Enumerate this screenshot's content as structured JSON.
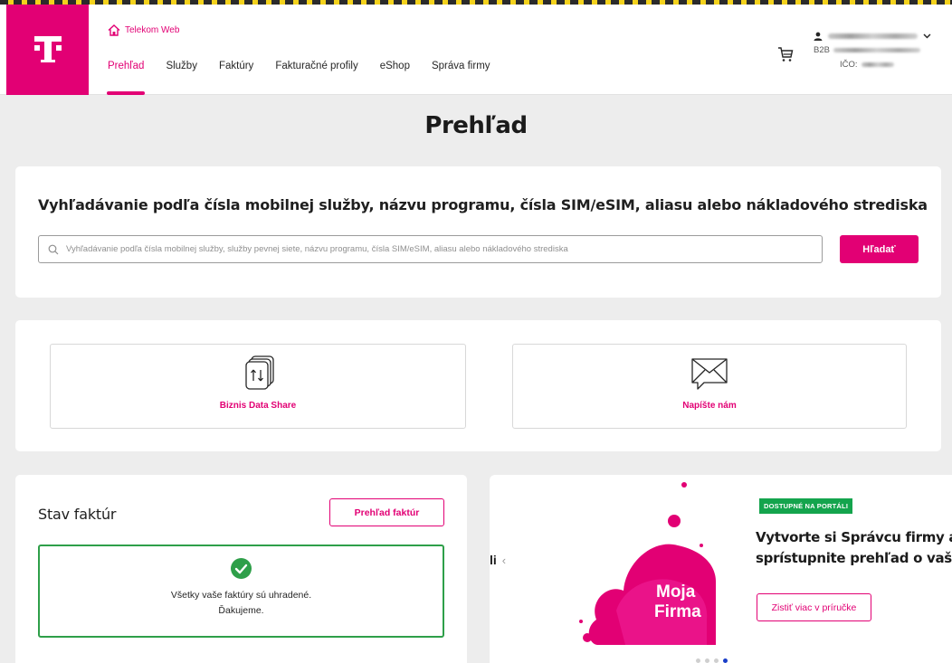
{
  "header": {
    "portal_label": "Telekom Web",
    "nav": [
      "Prehľad",
      "Služby",
      "Faktúry",
      "Fakturačné profily",
      "eShop",
      "Správa firmy"
    ],
    "active_nav": 0,
    "user": {
      "company_prefix": "B2B",
      "ico_label": "IČO:"
    }
  },
  "page": {
    "title": "Prehľad"
  },
  "search": {
    "heading": "Vyhľadávanie podľa čísla mobilnej služby, názvu programu, čísla SIM/eSIM, aliasu alebo nákladového strediska",
    "placeholder": "Vyhľadávanie podľa čísla mobilnej služby, služby pevnej siete, názvu programu, čísla SIM/eSIM, aliasu alebo nákladového strediska",
    "value": "",
    "button_label": "Hľadať"
  },
  "quick_links": [
    {
      "label": "Biznis Data Share",
      "icon": "data-share-icon"
    },
    {
      "label": "Napíšte nám",
      "icon": "mail-icon"
    }
  ],
  "invoices": {
    "title": "Stav faktúr",
    "button_label": "Prehľad faktúr",
    "status_line1": "Všetky vaše faktúry sú uhradené.",
    "status_line2": "Ďakujeme."
  },
  "promo": {
    "prev_text": "li",
    "badge": "DOSTUPNÉ NA PORTÁLI",
    "heading_line1": "Vytvorte si Správcu firmy a",
    "heading_line2": "sprístupnite prehľad o vaš",
    "button_label": "Zistiť viac v príručke",
    "art_text_line1": "Moja",
    "art_text_line2": "Firma",
    "slides_total": 4,
    "active_slide": 4
  },
  "colors": {
    "brand": "#e20074",
    "success": "#2e9f49",
    "badge": "#14a44d",
    "active_dot": "#1a3ec8"
  }
}
